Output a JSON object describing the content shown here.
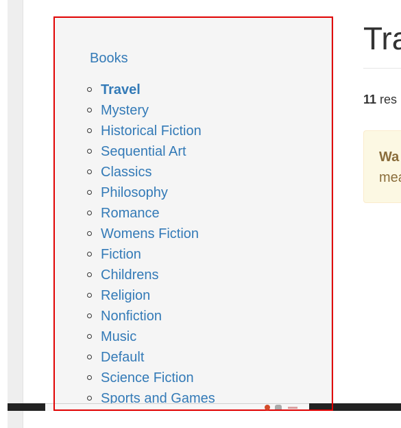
{
  "sidebar": {
    "root_label": "Books",
    "items": [
      {
        "label": "Travel",
        "active": true
      },
      {
        "label": "Mystery",
        "active": false
      },
      {
        "label": "Historical Fiction",
        "active": false
      },
      {
        "label": "Sequential Art",
        "active": false
      },
      {
        "label": "Classics",
        "active": false
      },
      {
        "label": "Philosophy",
        "active": false
      },
      {
        "label": "Romance",
        "active": false
      },
      {
        "label": "Womens Fiction",
        "active": false
      },
      {
        "label": "Fiction",
        "active": false
      },
      {
        "label": "Childrens",
        "active": false
      },
      {
        "label": "Religion",
        "active": false
      },
      {
        "label": "Nonfiction",
        "active": false
      },
      {
        "label": "Music",
        "active": false
      },
      {
        "label": "Default",
        "active": false
      },
      {
        "label": "Science Fiction",
        "active": false
      },
      {
        "label": "Sports and Games",
        "active": false
      }
    ]
  },
  "main": {
    "title": "Tra",
    "result_count": "11",
    "result_suffix": "res",
    "warning_strong": "Wa",
    "warning_text": "mea"
  },
  "colors": {
    "link": "#337ab7",
    "highlight_frame": "#e00000",
    "sidebar_bg": "#f5f5f5",
    "warning_bg": "#fcf8e3",
    "warning_text": "#8a6d3b"
  }
}
